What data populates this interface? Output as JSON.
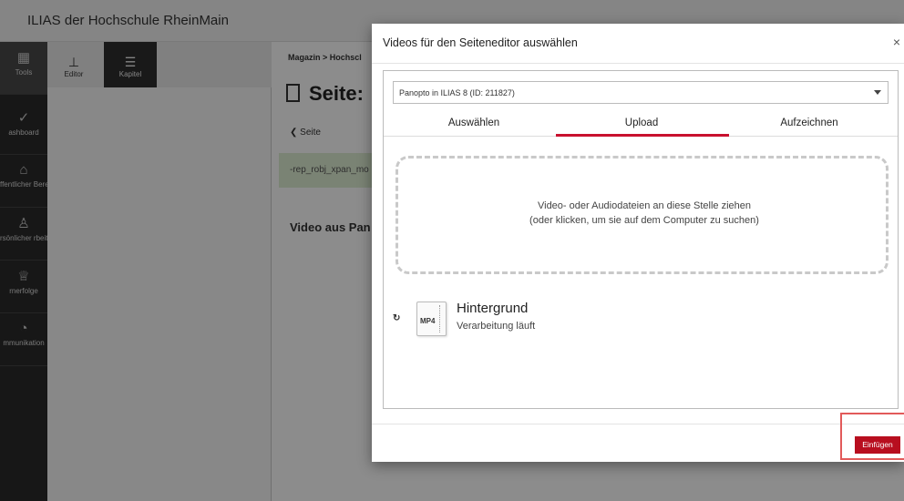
{
  "app": {
    "brand": "ILIAS der Hochschule RheinMain"
  },
  "mainbar": {
    "items": [
      {
        "label": "Tools",
        "icon": "tools-icon"
      },
      {
        "label": "ashboard",
        "icon": "dashboard-icon"
      },
      {
        "label": "ffentlicher Bereich",
        "icon": "public-area-icon"
      },
      {
        "label": "rsönlicher rbeitsraum",
        "icon": "personal-workspace-icon"
      },
      {
        "label": "rnerfolge",
        "icon": "trophy-icon"
      },
      {
        "label": "mmunikation",
        "icon": "communication-icon"
      }
    ]
  },
  "slate": {
    "editor_label": "Editor",
    "chapter_label": "Kapitel"
  },
  "background": {
    "breadcrumb": "Magazin  >  Hochscl",
    "page_title": "Seite:",
    "back_label": "Seite",
    "green_text": "-rep_robj_xpan_mo",
    "video_heading": "Video aus Pan"
  },
  "modal": {
    "title": "Videos für den Seiteneditor auswählen",
    "close_glyph": "×",
    "select_value": "Panopto in ILIAS 8 (ID: 211827)",
    "tabs": [
      "Auswählen",
      "Upload",
      "Aufzeichnen"
    ],
    "active_tab": "Upload",
    "dropzone_text": "Video- oder Audiodateien an diese Stelle ziehen (oder klicken, um sie auf dem Computer zu suchen)",
    "file": {
      "extension": "MP4",
      "name": "Hintergrund",
      "status": "Verarbeitung läuft"
    },
    "insert_button": "Einfügen"
  },
  "colors": {
    "accent": "#c8102e",
    "button": "#b80e1f",
    "highlight": "#e25a5a"
  }
}
